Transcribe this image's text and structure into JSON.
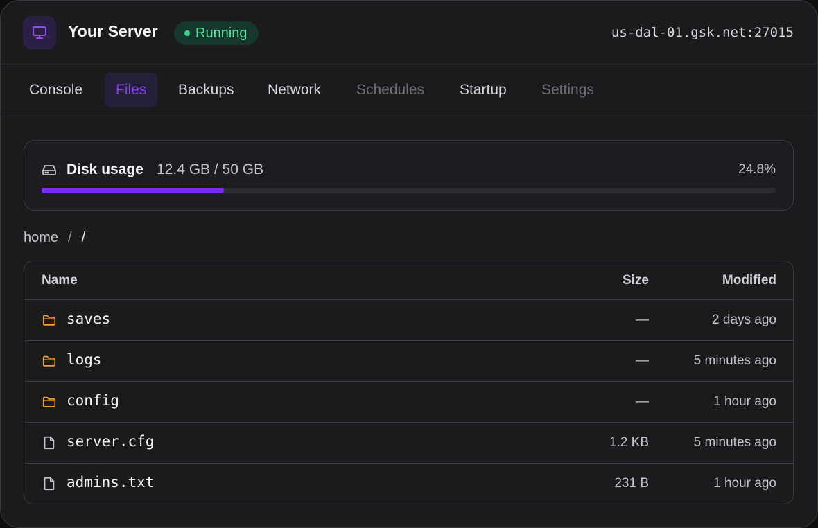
{
  "header": {
    "title": "Your Server",
    "status": "Running",
    "address": "us-dal-01.gsk.net:27015",
    "app_icon": "monitor-icon"
  },
  "tabs": [
    {
      "label": "Console",
      "state": "normal"
    },
    {
      "label": "Files",
      "state": "active"
    },
    {
      "label": "Backups",
      "state": "normal"
    },
    {
      "label": "Network",
      "state": "normal"
    },
    {
      "label": "Schedules",
      "state": "disabled"
    },
    {
      "label": "Startup",
      "state": "normal"
    },
    {
      "label": "Settings",
      "state": "disabled"
    }
  ],
  "disk": {
    "label": "Disk usage",
    "amount": "12.4 GB / 50 GB",
    "percent": "24.8%",
    "fraction": 0.248,
    "icon": "hard-drive-icon"
  },
  "breadcrumb": {
    "root": "home",
    "separator": "/",
    "current": "/"
  },
  "table": {
    "columns": {
      "name": "Name",
      "size": "Size",
      "modified": "Modified"
    },
    "rows": [
      {
        "name": "saves",
        "type": "folder",
        "size": "—",
        "modified": "2 days ago"
      },
      {
        "name": "logs",
        "type": "folder",
        "size": "—",
        "modified": "5 minutes ago"
      },
      {
        "name": "config",
        "type": "folder",
        "size": "—",
        "modified": "1 hour ago"
      },
      {
        "name": "server.cfg",
        "type": "file",
        "size": "1.2 KB",
        "modified": "5 minutes ago"
      },
      {
        "name": "admins.txt",
        "type": "file",
        "size": "231 B",
        "modified": "1 hour ago"
      }
    ]
  },
  "colors": {
    "accent": "#7b2fe8",
    "active_tab_text": "#8a3ff0",
    "status_green": "#5fe3a1",
    "folder": "#f0a23a"
  }
}
